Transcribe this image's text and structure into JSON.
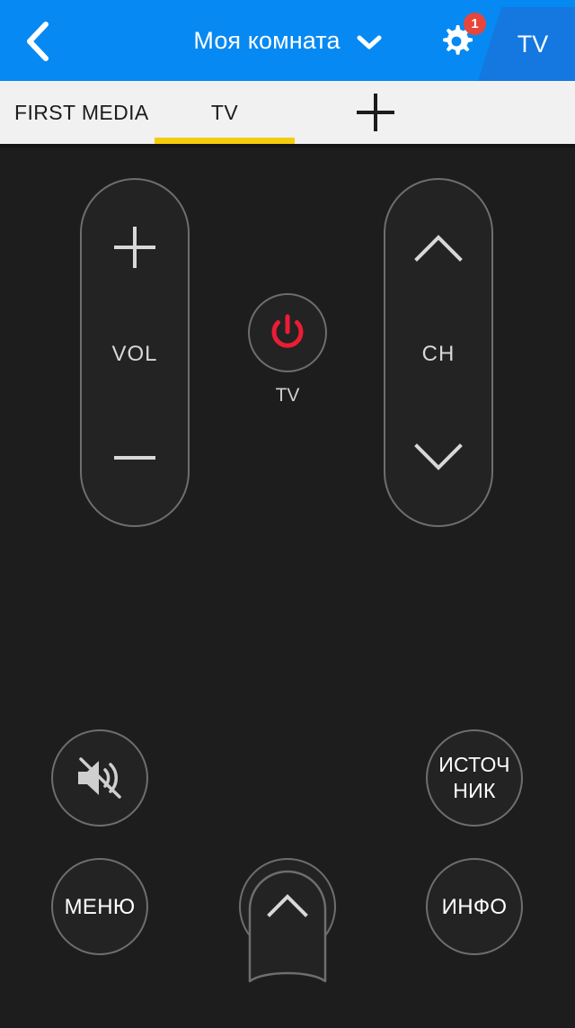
{
  "header": {
    "back_icon": "chevron-left-icon",
    "title": "Моя комната",
    "title_chevron_icon": "chevron-down-icon",
    "gear_icon": "gear-icon",
    "gear_badge_count": "1",
    "device_tab_label": "TV",
    "bg_color": "#0689f2",
    "device_tab_color": "#1478e0",
    "badge_color": "#e8453c"
  },
  "tabbar": {
    "bg_color": "#f1f1f1",
    "active_underline_color": "#f5cc0d",
    "tabs": [
      {
        "label": "FIRST MEDIA",
        "active": false
      },
      {
        "label": "TV",
        "active": true
      },
      {
        "label": "",
        "icon": "plus-icon",
        "active": false
      }
    ]
  },
  "remote": {
    "bg_color": "#1d1d1d",
    "outline_color": "#6e6e6e",
    "volume_rocker": {
      "up_icon": "plus-icon",
      "label": "VOL",
      "down_icon": "minus-icon"
    },
    "channel_rocker": {
      "up_icon": "chevron-up-icon",
      "label": "CH",
      "down_icon": "chevron-down-icon"
    },
    "power": {
      "icon": "power-icon",
      "icon_color": "#ec1c35",
      "label": "TV"
    },
    "buttons": [
      {
        "id": "mute",
        "icon": "mute-speaker-icon",
        "label": ""
      },
      {
        "id": "source",
        "label_line1": "ИСТОЧ",
        "label_line2": "НИК"
      },
      {
        "id": "menu",
        "label": "МЕНЮ"
      },
      {
        "id": "cube",
        "icon": "color-cube-icon",
        "label": ""
      },
      {
        "id": "info",
        "label": "ИНФО"
      }
    ],
    "drawer_handle": {
      "icon": "chevron-up-icon"
    }
  }
}
